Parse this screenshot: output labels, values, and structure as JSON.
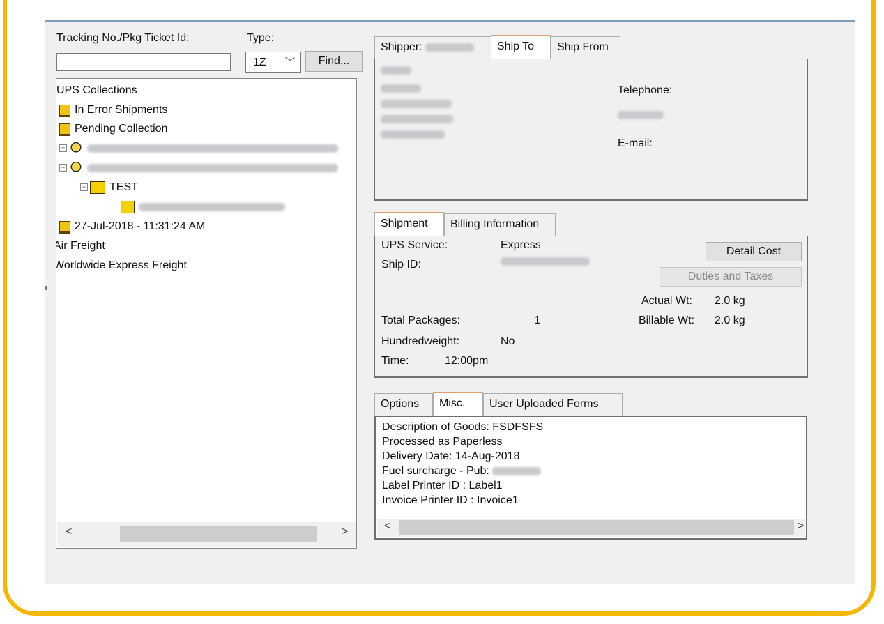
{
  "search": {
    "tracking_label": "Tracking No./Pkg Ticket Id:",
    "tracking_value": "",
    "type_label": "Type:",
    "type_value": "1Z",
    "find_label": "Find..."
  },
  "tree": {
    "root": "UPS Collections",
    "in_error": "In Error Shipments",
    "pending": "Pending Collection",
    "test_folder": "TEST",
    "date_item": "27-Jul-2018 - 11:31:24 AM",
    "air_freight": "Air Freight",
    "worldwide": "Worldwide Express Freight"
  },
  "top_tabs": {
    "shipper": "Shipper:",
    "ship_to": "Ship To",
    "ship_from": "Ship From"
  },
  "address": {
    "telephone_label": "Telephone:",
    "email_label": "E-mail:"
  },
  "mid_tabs": {
    "shipment": "Shipment",
    "billing": "Billing Information"
  },
  "shipment": {
    "service_label": "UPS Service:",
    "service_value": "Express",
    "ship_id_label": "Ship ID:",
    "detail_cost": "Detail Cost",
    "duties_taxes": "Duties and Taxes",
    "actual_wt_label": "Actual Wt:",
    "actual_wt_value": "2.0 kg",
    "billable_wt_label": "Billable Wt:",
    "billable_wt_value": "2.0 kg",
    "total_packages_label": "Total Packages:",
    "total_packages_value": "1",
    "hundredweight_label": "Hundredweight:",
    "hundredweight_value": "No",
    "time_label": "Time:",
    "time_value": "12:00pm"
  },
  "bottom_tabs": {
    "options": "Options",
    "misc": "Misc.",
    "user_forms": "User Uploaded Forms"
  },
  "misc": {
    "lines": [
      "Description of Goods: FSDFSFS",
      "Processed as Paperless",
      "Delivery Date: 14-Aug-2018",
      "Fuel surcharge - Pub:",
      "Label Printer ID : Label1",
      "Invoice Printer ID : Invoice1"
    ]
  },
  "colors": {
    "frame": "#f5b800",
    "window_bg": "#f0f0f0",
    "tab_accent": "#e0a070"
  }
}
